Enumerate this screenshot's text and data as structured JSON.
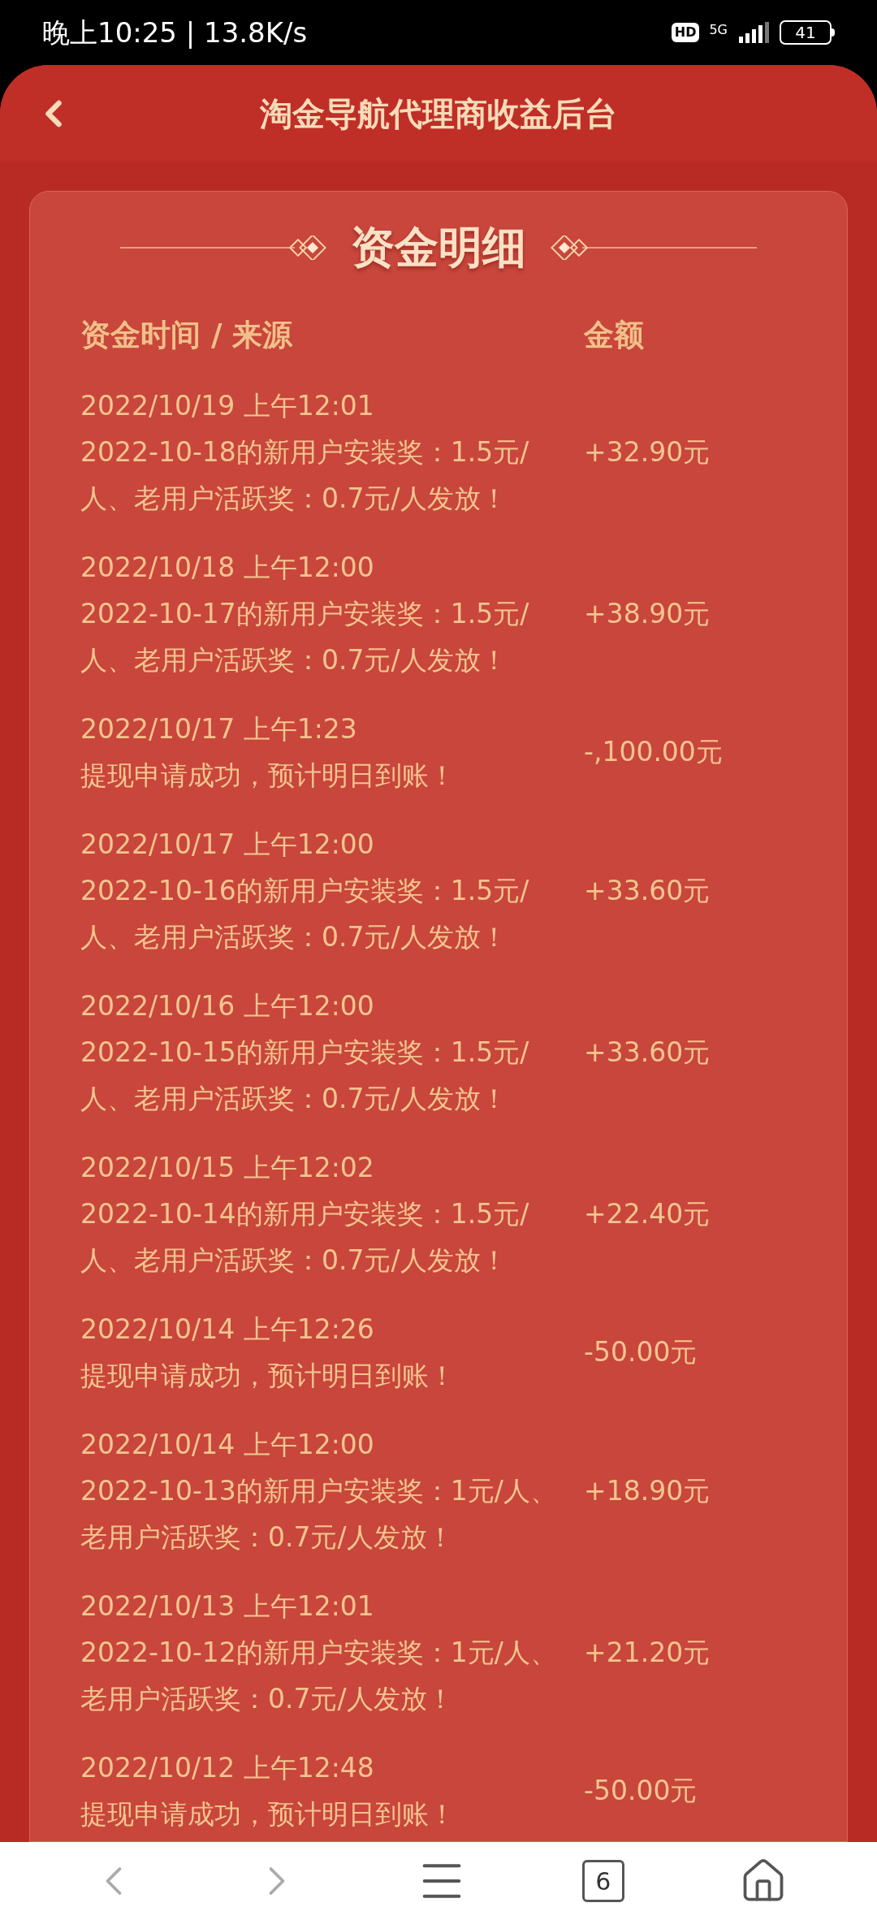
{
  "status_bar": {
    "time": "晚上10:25 | 13.8K/s",
    "hd": "HD",
    "network": "5G",
    "battery": "41"
  },
  "header": {
    "title": "淘金导航代理商收益后台"
  },
  "section_title": "资金明细",
  "columns": [
    "资金时间 / 来源",
    "金额"
  ],
  "entries": [
    {
      "time": "2022/10/19  上午12:01",
      "description": "2022-10-18的新用户安装奖：1.5元/人、老用户活跃奖：0.7元/人发放！",
      "amount": "+32.90元"
    },
    {
      "time": "2022/10/18  上午12:00",
      "description": "2022-10-17的新用户安装奖：1.5元/人、老用户活跃奖：0.7元/人发放！",
      "amount": "+38.90元"
    },
    {
      "time": "2022/10/17  上午1:23",
      "description": "提现申请成功，预计明日到账！",
      "amount": "-,100.00元"
    },
    {
      "time": "2022/10/17  上午12:00",
      "description": "2022-10-16的新用户安装奖：1.5元/人、老用户活跃奖：0.7元/人发放！",
      "amount": "+33.60元"
    },
    {
      "time": "2022/10/16  上午12:00",
      "description": "2022-10-15的新用户安装奖：1.5元/人、老用户活跃奖：0.7元/人发放！",
      "amount": "+33.60元"
    },
    {
      "time": "2022/10/15  上午12:02",
      "description": "2022-10-14的新用户安装奖：1.5元/人、老用户活跃奖：0.7元/人发放！",
      "amount": "+22.40元"
    },
    {
      "time": "2022/10/14  上午12:26",
      "description": "提现申请成功，预计明日到账！",
      "amount": "-50.00元"
    },
    {
      "time": "2022/10/14  上午12:00",
      "description": "2022-10-13的新用户安装奖：1元/人、老用户活跃奖：0.7元/人发放！",
      "amount": "+18.90元"
    },
    {
      "time": "2022/10/13  上午12:01",
      "description": "2022-10-12的新用户安装奖：1元/人、老用户活跃奖：0.7元/人发放！",
      "amount": "+21.20元"
    },
    {
      "time": "2022/10/12  上午12:48",
      "description": "提现申请成功，预计明日到账！",
      "amount": "-50.00元"
    }
  ],
  "nav": {
    "tab_count": "6"
  }
}
